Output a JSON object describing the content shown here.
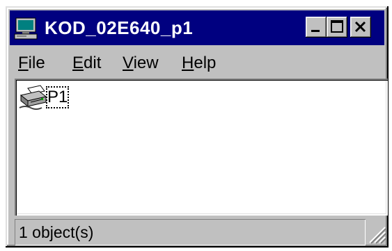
{
  "window": {
    "title": "KOD_02E640_p1",
    "title_icon": "computer-icon",
    "controls": {
      "minimize": "minimize-icon",
      "maximize": "maximize-icon",
      "close": "close-icon"
    }
  },
  "menu": {
    "items": [
      {
        "accel": "F",
        "rest": "ile"
      },
      {
        "accel": "E",
        "rest": "dit"
      },
      {
        "accel": "V",
        "rest": "iew"
      },
      {
        "accel": "H",
        "rest": "elp"
      }
    ]
  },
  "content": {
    "items": [
      {
        "label": "P1",
        "icon": "printer-icon"
      }
    ]
  },
  "status": {
    "text": "1 object(s)"
  },
  "colors": {
    "title_bar": "#000080",
    "face": "#c0c0c0",
    "content_bg": "#ffffff"
  }
}
